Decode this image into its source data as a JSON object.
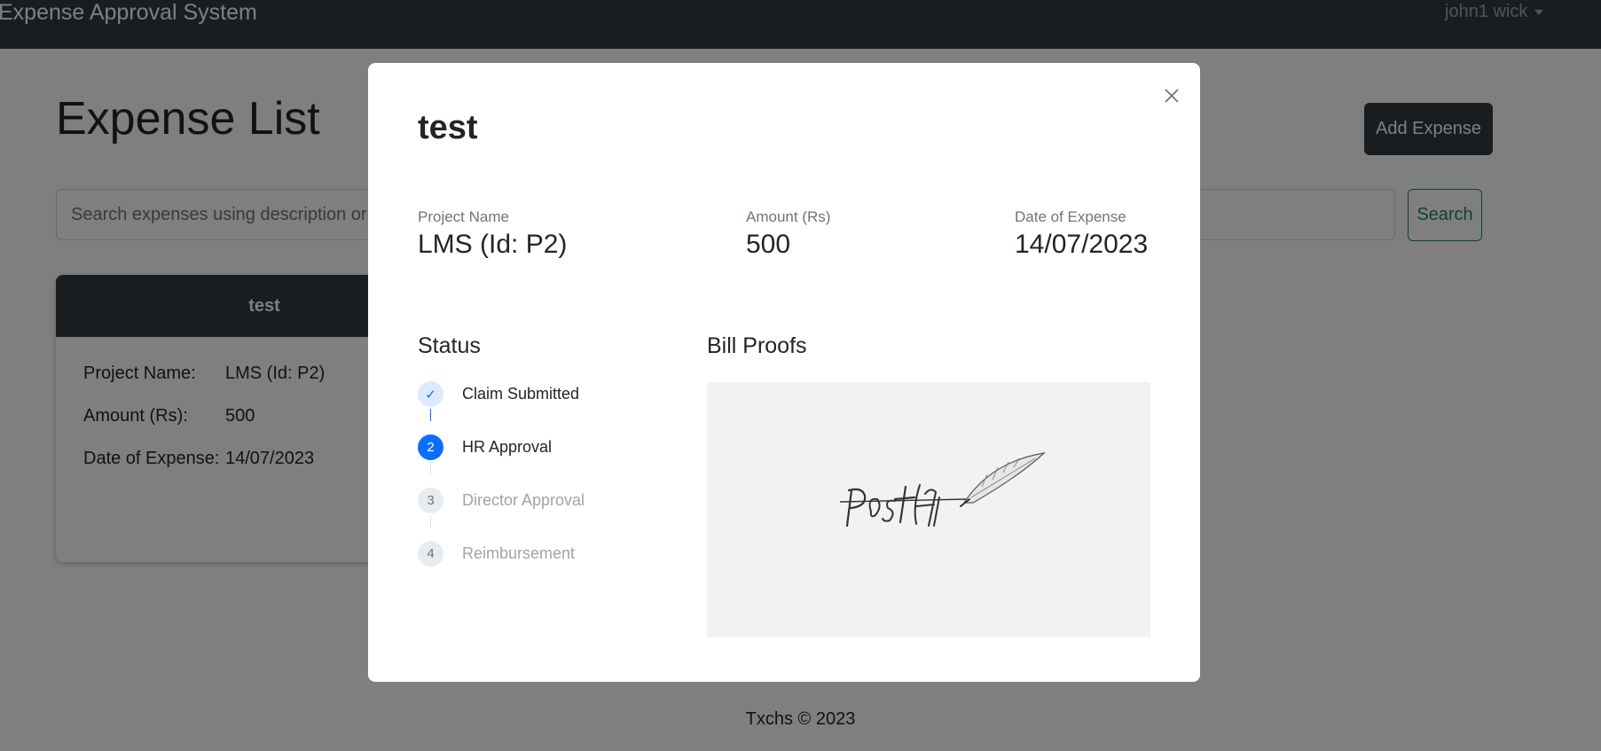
{
  "navbar": {
    "brand": "Expense Approval System",
    "user": "john1 wick"
  },
  "page": {
    "title": "Expense List",
    "add_button": "Add Expense",
    "search_placeholder": "Search expenses using description or project name",
    "search_button": "Search"
  },
  "card": {
    "title": "test",
    "rows": [
      {
        "label": "Project Name:",
        "value": "LMS (Id: P2)"
      },
      {
        "label": "Amount (Rs):",
        "value": "500"
      },
      {
        "label": "Date of Expense:",
        "value": "14/07/2023"
      }
    ]
  },
  "footer": "Txchs © 2023",
  "modal": {
    "title": "test",
    "fields": {
      "project": {
        "label": "Project Name",
        "value": "LMS (Id: P2)"
      },
      "amount": {
        "label": "Amount (Rs)",
        "value": "500"
      },
      "date": {
        "label": "Date of Expense",
        "value": "14/07/2023"
      }
    },
    "status_title": "Status",
    "bill_title": "Bill Proofs",
    "steps": [
      {
        "number": "✓",
        "label": "Claim Submitted",
        "state": "done"
      },
      {
        "number": "2",
        "label": "HR Approval",
        "state": "active"
      },
      {
        "number": "3",
        "label": "Director Approval",
        "state": "pending"
      },
      {
        "number": "4",
        "label": "Reimbursement",
        "state": "pending"
      }
    ],
    "bill_image_text": "PostIt"
  },
  "colors": {
    "navbar": "#343a40",
    "primary": "#0d6efd",
    "success": "#198754"
  }
}
